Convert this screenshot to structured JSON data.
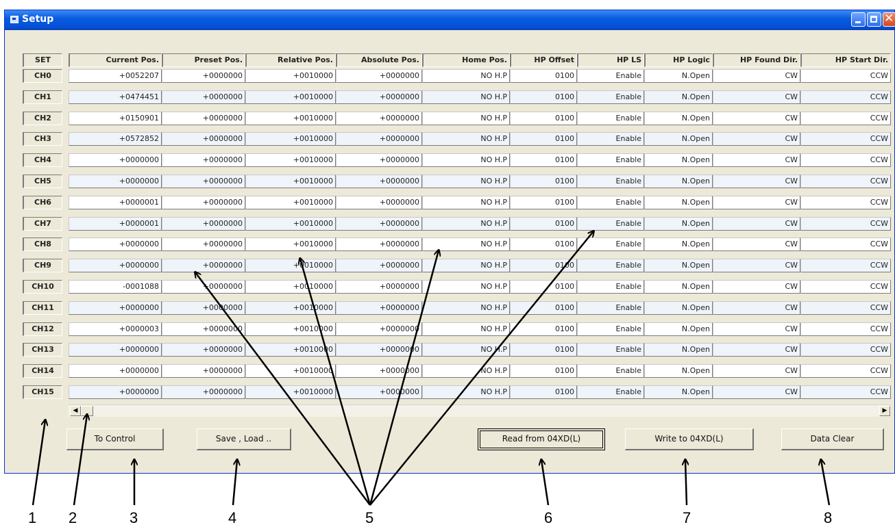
{
  "window": {
    "title": "Setup"
  },
  "columns": [
    "Current Pos.",
    "Preset Pos.",
    "Relative Pos.",
    "Absolute Pos.",
    "Home Pos.",
    "HP Offset",
    "HP LS",
    "HP Logic",
    "HP Found Dir.",
    "HP Start Dir."
  ],
  "set_label": "SET",
  "rows": [
    {
      "ch": "CH0",
      "values": [
        "+0052207",
        "+0000000",
        "+0010000",
        "+0000000",
        "NO H.P",
        "0100",
        "Enable",
        "N.Open",
        "CW",
        "CCW"
      ]
    },
    {
      "ch": "CH1",
      "values": [
        "+0474451",
        "+0000000",
        "+0010000",
        "+0000000",
        "NO H.P",
        "0100",
        "Enable",
        "N.Open",
        "CW",
        "CCW"
      ]
    },
    {
      "ch": "CH2",
      "values": [
        "+0150901",
        "+0000000",
        "+0010000",
        "+0000000",
        "NO H.P",
        "0100",
        "Enable",
        "N.Open",
        "CW",
        "CCW"
      ]
    },
    {
      "ch": "CH3",
      "values": [
        "+0572852",
        "+0000000",
        "+0010000",
        "+0000000",
        "NO H.P",
        "0100",
        "Enable",
        "N.Open",
        "CW",
        "CCW"
      ]
    },
    {
      "ch": "CH4",
      "values": [
        "+0000000",
        "+0000000",
        "+0010000",
        "+0000000",
        "NO H.P",
        "0100",
        "Enable",
        "N.Open",
        "CW",
        "CCW"
      ]
    },
    {
      "ch": "CH5",
      "values": [
        "+0000000",
        "+0000000",
        "+0010000",
        "+0000000",
        "NO H.P",
        "0100",
        "Enable",
        "N.Open",
        "CW",
        "CCW"
      ]
    },
    {
      "ch": "CH6",
      "values": [
        "+0000001",
        "+0000000",
        "+0010000",
        "+0000000",
        "NO H.P",
        "0100",
        "Enable",
        "N.Open",
        "CW",
        "CCW"
      ]
    },
    {
      "ch": "CH7",
      "values": [
        "+0000001",
        "+0000000",
        "+0010000",
        "+0000000",
        "NO H.P",
        "0100",
        "Enable",
        "N.Open",
        "CW",
        "CCW"
      ]
    },
    {
      "ch": "CH8",
      "values": [
        "+0000000",
        "+0000000",
        "+0010000",
        "+0000000",
        "NO H.P",
        "0100",
        "Enable",
        "N.Open",
        "CW",
        "CCW"
      ]
    },
    {
      "ch": "CH9",
      "values": [
        "+0000000",
        "+0000000",
        "+0010000",
        "+0000000",
        "NO H.P",
        "0100",
        "Enable",
        "N.Open",
        "CW",
        "CCW"
      ]
    },
    {
      "ch": "CH10",
      "values": [
        "-0001088",
        "+0000000",
        "+0010000",
        "+0000000",
        "NO H.P",
        "0100",
        "Enable",
        "N.Open",
        "CW",
        "CCW"
      ]
    },
    {
      "ch": "CH11",
      "values": [
        "+0000000",
        "+0000000",
        "+0010000",
        "+0000000",
        "NO H.P",
        "0100",
        "Enable",
        "N.Open",
        "CW",
        "CCW"
      ]
    },
    {
      "ch": "CH12",
      "values": [
        "+0000003",
        "+0000000",
        "+0010000",
        "+0000000",
        "NO H.P",
        "0100",
        "Enable",
        "N.Open",
        "CW",
        "CCW"
      ]
    },
    {
      "ch": "CH13",
      "values": [
        "+0000000",
        "+0000000",
        "+0010000",
        "+0000000",
        "NO H.P",
        "0100",
        "Enable",
        "N.Open",
        "CW",
        "CCW"
      ]
    },
    {
      "ch": "CH14",
      "values": [
        "+0000000",
        "+0000000",
        "+0010000",
        "+0000000",
        "NO H.P",
        "0100",
        "Enable",
        "N.Open",
        "CW",
        "CCW"
      ]
    },
    {
      "ch": "CH15",
      "values": [
        "+0000000",
        "+0000000",
        "+0010000",
        "+0000000",
        "NO H.P",
        "0100",
        "Enable",
        "N.Open",
        "CW",
        "CCW"
      ]
    }
  ],
  "buttons": {
    "to_control": "To Control",
    "save_load": "Save , Load ..",
    "read": "Read from 04XD(L)",
    "write": "Write to 04XD(L)",
    "clear": "Data Clear"
  },
  "callouts": [
    "1",
    "2",
    "3",
    "4",
    "5",
    "6",
    "7",
    "8"
  ],
  "colors": {
    "title_bar": "#0a5be0",
    "window_bg": "#ece9d8",
    "row_alt": "#eff4fa"
  }
}
